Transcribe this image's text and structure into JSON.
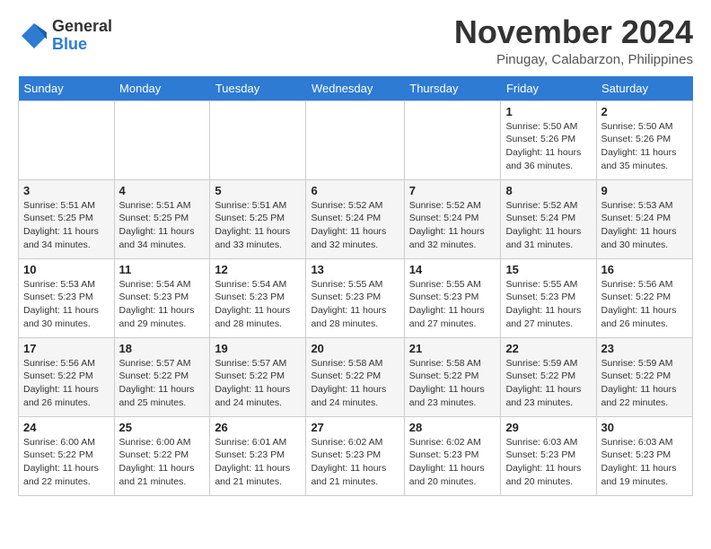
{
  "header": {
    "logo_general": "General",
    "logo_blue": "Blue",
    "month_title": "November 2024",
    "subtitle": "Pinugay, Calabarzon, Philippines"
  },
  "weekdays": [
    "Sunday",
    "Monday",
    "Tuesday",
    "Wednesday",
    "Thursday",
    "Friday",
    "Saturday"
  ],
  "weeks": [
    [
      {
        "day": "",
        "info": ""
      },
      {
        "day": "",
        "info": ""
      },
      {
        "day": "",
        "info": ""
      },
      {
        "day": "",
        "info": ""
      },
      {
        "day": "",
        "info": ""
      },
      {
        "day": "1",
        "info": "Sunrise: 5:50 AM\nSunset: 5:26 PM\nDaylight: 11 hours\nand 36 minutes."
      },
      {
        "day": "2",
        "info": "Sunrise: 5:50 AM\nSunset: 5:26 PM\nDaylight: 11 hours\nand 35 minutes."
      }
    ],
    [
      {
        "day": "3",
        "info": "Sunrise: 5:51 AM\nSunset: 5:25 PM\nDaylight: 11 hours\nand 34 minutes."
      },
      {
        "day": "4",
        "info": "Sunrise: 5:51 AM\nSunset: 5:25 PM\nDaylight: 11 hours\nand 34 minutes."
      },
      {
        "day": "5",
        "info": "Sunrise: 5:51 AM\nSunset: 5:25 PM\nDaylight: 11 hours\nand 33 minutes."
      },
      {
        "day": "6",
        "info": "Sunrise: 5:52 AM\nSunset: 5:24 PM\nDaylight: 11 hours\nand 32 minutes."
      },
      {
        "day": "7",
        "info": "Sunrise: 5:52 AM\nSunset: 5:24 PM\nDaylight: 11 hours\nand 32 minutes."
      },
      {
        "day": "8",
        "info": "Sunrise: 5:52 AM\nSunset: 5:24 PM\nDaylight: 11 hours\nand 31 minutes."
      },
      {
        "day": "9",
        "info": "Sunrise: 5:53 AM\nSunset: 5:24 PM\nDaylight: 11 hours\nand 30 minutes."
      }
    ],
    [
      {
        "day": "10",
        "info": "Sunrise: 5:53 AM\nSunset: 5:23 PM\nDaylight: 11 hours\nand 30 minutes."
      },
      {
        "day": "11",
        "info": "Sunrise: 5:54 AM\nSunset: 5:23 PM\nDaylight: 11 hours\nand 29 minutes."
      },
      {
        "day": "12",
        "info": "Sunrise: 5:54 AM\nSunset: 5:23 PM\nDaylight: 11 hours\nand 28 minutes."
      },
      {
        "day": "13",
        "info": "Sunrise: 5:55 AM\nSunset: 5:23 PM\nDaylight: 11 hours\nand 28 minutes."
      },
      {
        "day": "14",
        "info": "Sunrise: 5:55 AM\nSunset: 5:23 PM\nDaylight: 11 hours\nand 27 minutes."
      },
      {
        "day": "15",
        "info": "Sunrise: 5:55 AM\nSunset: 5:23 PM\nDaylight: 11 hours\nand 27 minutes."
      },
      {
        "day": "16",
        "info": "Sunrise: 5:56 AM\nSunset: 5:22 PM\nDaylight: 11 hours\nand 26 minutes."
      }
    ],
    [
      {
        "day": "17",
        "info": "Sunrise: 5:56 AM\nSunset: 5:22 PM\nDaylight: 11 hours\nand 26 minutes."
      },
      {
        "day": "18",
        "info": "Sunrise: 5:57 AM\nSunset: 5:22 PM\nDaylight: 11 hours\nand 25 minutes."
      },
      {
        "day": "19",
        "info": "Sunrise: 5:57 AM\nSunset: 5:22 PM\nDaylight: 11 hours\nand 24 minutes."
      },
      {
        "day": "20",
        "info": "Sunrise: 5:58 AM\nSunset: 5:22 PM\nDaylight: 11 hours\nand 24 minutes."
      },
      {
        "day": "21",
        "info": "Sunrise: 5:58 AM\nSunset: 5:22 PM\nDaylight: 11 hours\nand 23 minutes."
      },
      {
        "day": "22",
        "info": "Sunrise: 5:59 AM\nSunset: 5:22 PM\nDaylight: 11 hours\nand 23 minutes."
      },
      {
        "day": "23",
        "info": "Sunrise: 5:59 AM\nSunset: 5:22 PM\nDaylight: 11 hours\nand 22 minutes."
      }
    ],
    [
      {
        "day": "24",
        "info": "Sunrise: 6:00 AM\nSunset: 5:22 PM\nDaylight: 11 hours\nand 22 minutes."
      },
      {
        "day": "25",
        "info": "Sunrise: 6:00 AM\nSunset: 5:22 PM\nDaylight: 11 hours\nand 21 minutes."
      },
      {
        "day": "26",
        "info": "Sunrise: 6:01 AM\nSunset: 5:23 PM\nDaylight: 11 hours\nand 21 minutes."
      },
      {
        "day": "27",
        "info": "Sunrise: 6:02 AM\nSunset: 5:23 PM\nDaylight: 11 hours\nand 21 minutes."
      },
      {
        "day": "28",
        "info": "Sunrise: 6:02 AM\nSunset: 5:23 PM\nDaylight: 11 hours\nand 20 minutes."
      },
      {
        "day": "29",
        "info": "Sunrise: 6:03 AM\nSunset: 5:23 PM\nDaylight: 11 hours\nand 20 minutes."
      },
      {
        "day": "30",
        "info": "Sunrise: 6:03 AM\nSunset: 5:23 PM\nDaylight: 11 hours\nand 19 minutes."
      }
    ]
  ]
}
